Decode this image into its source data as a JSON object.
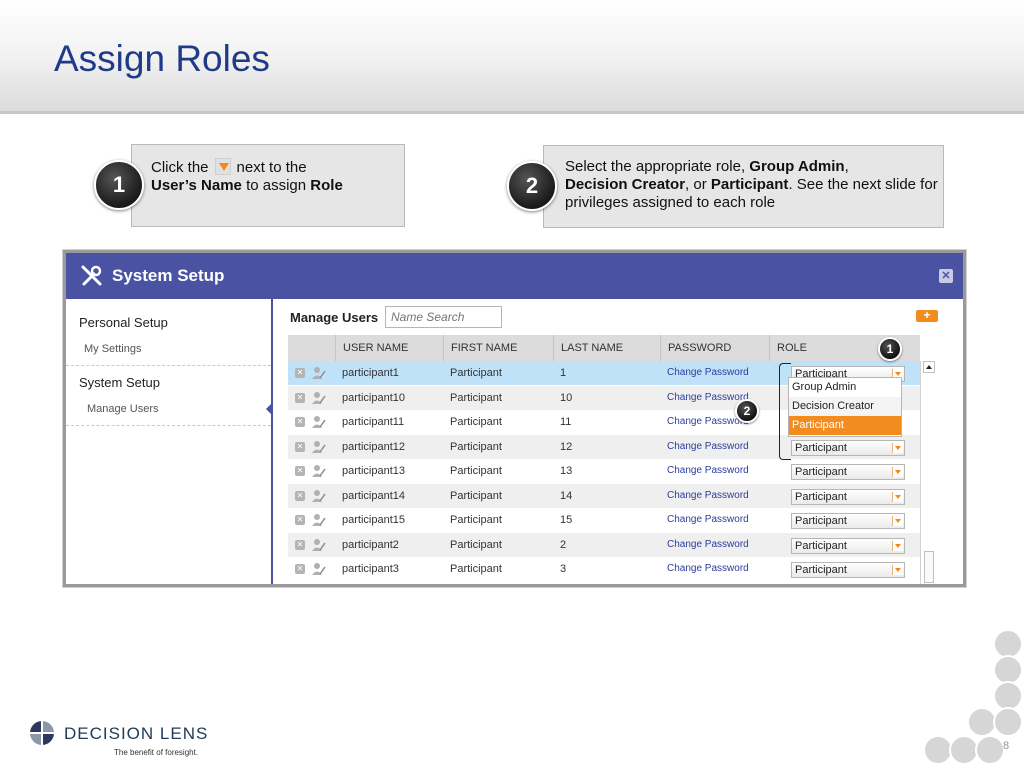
{
  "slide": {
    "title": "Assign Roles",
    "page_number": "8"
  },
  "callouts": [
    {
      "step": "1",
      "line1_pre": "Click the",
      "line1_post": "next to the",
      "line2_bold": "User’s Name",
      "line2_mid": "to assign",
      "line2_bold2": "Role"
    },
    {
      "step": "2",
      "pre": "Select the appropriate role,",
      "bold1": "Group Admin",
      "sep1": ",",
      "bold2": "Decision Creator",
      "sep2": ", or",
      "bold3": "Participant",
      "post": ". See the next slide for privileges assigned to each role"
    }
  ],
  "window": {
    "title": "System Setup",
    "close_glyph": "✕"
  },
  "sidebar": {
    "sections": [
      {
        "heading": "Personal Setup",
        "items": [
          "My Settings"
        ]
      },
      {
        "heading": "System Setup",
        "items": [
          "Manage Users"
        ]
      }
    ]
  },
  "manage": {
    "label": "Manage Users",
    "search_placeholder": "Name Search",
    "add_glyph": "+"
  },
  "table": {
    "columns": [
      "USER NAME",
      "FIRST NAME",
      "LAST NAME",
      "PASSWORD",
      "ROLE"
    ],
    "rows": [
      {
        "user": "participant1",
        "first": "Participant",
        "last": "1",
        "password": "Change Password",
        "role": "Participant"
      },
      {
        "user": "participant10",
        "first": "Participant",
        "last": "10",
        "password": "Change Password",
        "role": ""
      },
      {
        "user": "participant11",
        "first": "Participant",
        "last": "11",
        "password": "Change Password",
        "role": ""
      },
      {
        "user": "participant12",
        "first": "Participant",
        "last": "12",
        "password": "Change Password",
        "role": "Participant"
      },
      {
        "user": "participant13",
        "first": "Participant",
        "last": "13",
        "password": "Change Password",
        "role": "Participant"
      },
      {
        "user": "participant14",
        "first": "Participant",
        "last": "14",
        "password": "Change Password",
        "role": "Participant"
      },
      {
        "user": "participant15",
        "first": "Participant",
        "last": "15",
        "password": "Change Password",
        "role": "Participant"
      },
      {
        "user": "participant2",
        "first": "Participant",
        "last": "2",
        "password": "Change Password",
        "role": "Participant"
      },
      {
        "user": "participant3",
        "first": "Participant",
        "last": "3",
        "password": "Change Password",
        "role": "Participant"
      }
    ],
    "role_dropdown_options": [
      "Group Admin",
      "Decision Creator",
      "Participant"
    ],
    "markers": [
      "1",
      "2"
    ]
  },
  "footer": {
    "brand": "DECISION LENS",
    "tagline": "The benefit of foresight."
  },
  "colors": {
    "title_blue": "#1f3a86",
    "header_purple": "#4a52a3",
    "accent_orange": "#f28c1e",
    "selected_row": "#bfe2f8",
    "link_blue": "#2d3d9a"
  },
  "icons": [
    "tools-icon",
    "close-icon",
    "delete-icon",
    "edit-user-icon",
    "dropdown-arrow-icon",
    "add-icon",
    "logo-icon",
    "scroll-up-icon"
  ]
}
